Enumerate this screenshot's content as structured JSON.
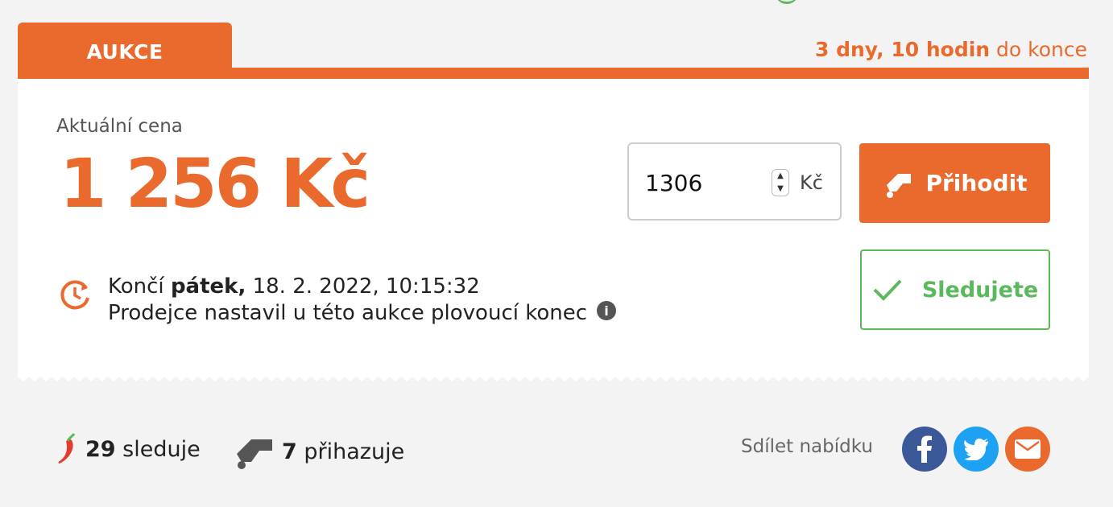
{
  "tab": {
    "label": "AUKCE"
  },
  "countdown": {
    "bold": "3 dny, 10 hodin",
    "rest": " do konce"
  },
  "price": {
    "label": "Aktuální cena",
    "value": "1 256 Kč"
  },
  "bid": {
    "value": "1306",
    "currency": "Kč",
    "button_label": "Přihodit"
  },
  "watch": {
    "label": "Sledujete"
  },
  "ends": {
    "prefix": "Končí ",
    "day": "pátek,",
    "datetime": " 18. 2. 2022, 10:15:32"
  },
  "seller_note": "Prodejce nastavil u této aukce plovoucí konec",
  "stats": {
    "watchers": {
      "count": "29",
      "label": " sleduje"
    },
    "bidders": {
      "count": "7",
      "label": " přihazuje"
    }
  },
  "share": {
    "label": "Sdílet nabídku",
    "buttons": [
      "facebook-icon",
      "twitter-icon",
      "mail-icon"
    ]
  },
  "colors": {
    "accent": "#ea6a2e",
    "success": "#5cb85c",
    "facebook": "#3b5998",
    "twitter": "#1da1f2"
  }
}
